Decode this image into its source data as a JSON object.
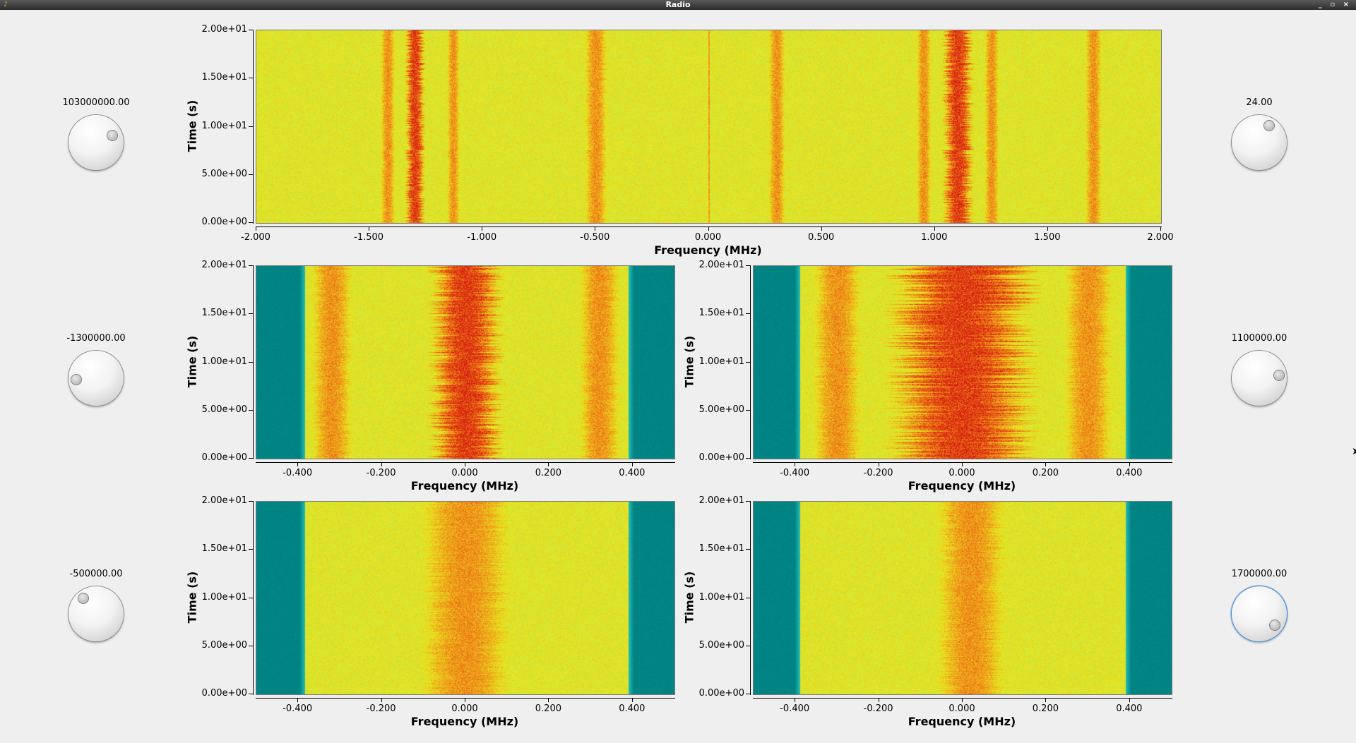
{
  "window": {
    "title": "Radio",
    "controls": [
      "_",
      "▫",
      "×"
    ]
  },
  "knobs": [
    {
      "id": "center-freq",
      "value": "103000000.00",
      "focused": false
    },
    {
      "id": "offset-1",
      "value": "-1300000.00",
      "focused": false
    },
    {
      "id": "offset-3",
      "value": "-500000.00",
      "focused": false
    },
    {
      "id": "gain",
      "value": "24.00",
      "focused": false
    },
    {
      "id": "offset-2",
      "value": "1100000.00",
      "focused": false
    },
    {
      "id": "offset-4",
      "value": "1700000.00",
      "focused": true
    }
  ],
  "colors": {
    "background_field": "#e8e820",
    "strong": "#d62010",
    "medium": "#f08018",
    "weak": "#80e880",
    "floor": "#008080"
  },
  "plots": [
    {
      "id": "wideband",
      "ylabel": "Time (s)",
      "xlabel": "Frequency (MHz)",
      "yticks": [
        "2.00e+01",
        "1.50e+01",
        "1.00e+01",
        "5.00e+00",
        "0.00e+00"
      ],
      "xticks": [
        "-2.000",
        "-1.500",
        "-1.000",
        "-0.500",
        "0.000",
        "0.500",
        "1.000",
        "1.500",
        "2.000"
      ],
      "xrange": [
        -2.0,
        2.0
      ],
      "yrange": [
        0,
        20
      ],
      "bands": [
        {
          "center": -1.42,
          "width": 0.08,
          "level": "medium"
        },
        {
          "center": -1.3,
          "width": 0.09,
          "level": "strong"
        },
        {
          "center": -1.13,
          "width": 0.07,
          "level": "medium"
        },
        {
          "center": -0.5,
          "width": 0.12,
          "level": "medium"
        },
        {
          "center": 0.0,
          "width": 0.012,
          "level": "medium"
        },
        {
          "center": 0.3,
          "width": 0.09,
          "level": "medium"
        },
        {
          "center": 0.95,
          "width": 0.08,
          "level": "medium"
        },
        {
          "center": 1.1,
          "width": 0.14,
          "level": "strong"
        },
        {
          "center": 1.25,
          "width": 0.08,
          "level": "medium"
        },
        {
          "center": 1.7,
          "width": 0.09,
          "level": "medium"
        }
      ],
      "floor_edges": null
    },
    {
      "id": "channel-1",
      "ylabel": "Time (s)",
      "xlabel": "Frequency (MHz)",
      "yticks": [
        "2.00e+01",
        "1.50e+01",
        "1.00e+01",
        "5.00e+00",
        "0.00e+00"
      ],
      "xticks": [
        "-0.400",
        "-0.200",
        "0.000",
        "0.200",
        "0.400"
      ],
      "xrange": [
        -0.5,
        0.5
      ],
      "yrange": [
        0,
        20
      ],
      "bands": [
        {
          "center": 0.0,
          "width": 0.18,
          "level": "strong"
        },
        {
          "center": -0.32,
          "width": 0.12,
          "level": "medium"
        },
        {
          "center": 0.32,
          "width": 0.12,
          "level": "medium"
        }
      ],
      "floor_edges": [
        -0.385,
        0.39
      ]
    },
    {
      "id": "channel-2",
      "ylabel": "Time (s)",
      "xlabel": "Frequency (MHz)",
      "yticks": [
        "2.00e+01",
        "1.50e+01",
        "1.00e+01",
        "5.00e+00",
        "0.00e+00"
      ],
      "xticks": [
        "-0.400",
        "-0.200",
        "0.000",
        "0.200",
        "0.400"
      ],
      "xrange": [
        -0.5,
        0.5
      ],
      "yrange": [
        0,
        20
      ],
      "bands": [
        {
          "center": 0.0,
          "width": 0.36,
          "level": "strong"
        },
        {
          "center": -0.3,
          "width": 0.14,
          "level": "medium"
        },
        {
          "center": 0.3,
          "width": 0.14,
          "level": "medium"
        }
      ],
      "floor_edges": [
        -0.39,
        0.39
      ]
    },
    {
      "id": "channel-3",
      "ylabel": "Time (s)",
      "xlabel": "Frequency (MHz)",
      "yticks": [
        "2.00e+01",
        "1.50e+01",
        "1.00e+01",
        "5.00e+00",
        "0.00e+00"
      ],
      "xticks": [
        "-0.400",
        "-0.200",
        "0.000",
        "0.200",
        "0.400"
      ],
      "xrange": [
        -0.5,
        0.5
      ],
      "yrange": [
        0,
        20
      ],
      "bands": [
        {
          "center": 0.0,
          "width": 0.26,
          "level": "medium"
        }
      ],
      "floor_edges": [
        -0.385,
        0.39
      ]
    },
    {
      "id": "channel-4",
      "ylabel": "Time (s)",
      "xlabel": "Frequency (MHz)",
      "yticks": [
        "2.00e+01",
        "1.50e+01",
        "1.00e+01",
        "5.00e+00",
        "0.00e+00"
      ],
      "xticks": [
        "-0.400",
        "-0.200",
        "0.000",
        "0.200",
        "0.400"
      ],
      "xrange": [
        -0.5,
        0.5
      ],
      "yrange": [
        0,
        20
      ],
      "bands": [
        {
          "center": 0.02,
          "width": 0.2,
          "level": "medium"
        }
      ],
      "floor_edges": [
        -0.39,
        0.39
      ]
    }
  ]
}
